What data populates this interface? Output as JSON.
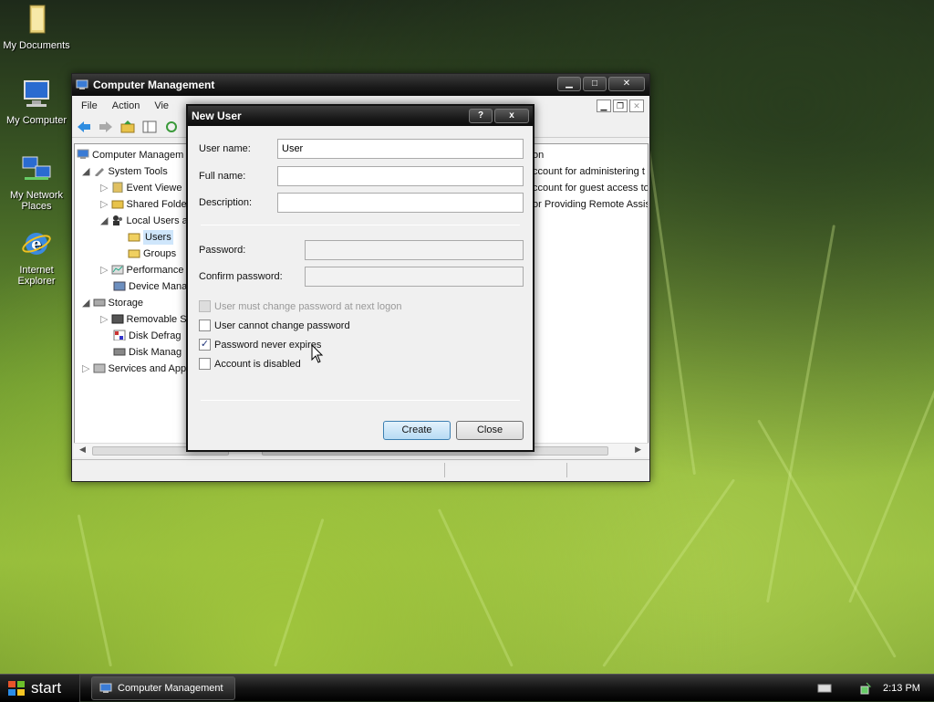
{
  "desktop": {
    "icons": [
      {
        "label": "My Documents",
        "icon": "folder-icon"
      },
      {
        "label": "My Computer",
        "icon": "computer-icon"
      },
      {
        "label": "My Network Places",
        "icon": "network-icon"
      },
      {
        "label": "Internet Explorer",
        "icon": "ie-icon"
      }
    ]
  },
  "cm_window": {
    "title": "Computer Management",
    "menu": [
      "File",
      "Action",
      "Vie"
    ],
    "tree": [
      {
        "label": "Computer Managem",
        "icon": "computer-icon"
      },
      {
        "label": "System Tools",
        "icon": "tools-icon"
      },
      {
        "label": "Event Viewe",
        "icon": "event-icon"
      },
      {
        "label": "Shared Folde",
        "icon": "shared-folder-icon"
      },
      {
        "label": "Local Users a",
        "icon": "users-icon"
      },
      {
        "label": "Users",
        "icon": "folder-icon"
      },
      {
        "label": "Groups",
        "icon": "folder-icon"
      },
      {
        "label": "Performance",
        "icon": "performance-icon"
      },
      {
        "label": "Device Mana",
        "icon": "device-icon"
      },
      {
        "label": "Storage",
        "icon": "storage-icon"
      },
      {
        "label": "Removable S",
        "icon": "removable-icon"
      },
      {
        "label": "Disk Defrag",
        "icon": "defrag-icon"
      },
      {
        "label": "Disk Manag",
        "icon": "disk-icon"
      },
      {
        "label": "Services and App",
        "icon": "services-icon"
      }
    ],
    "list_fragments": [
      "on",
      "ccount for administering t",
      "ccount for guest access to",
      "or Providing Remote Assis"
    ]
  },
  "new_user": {
    "title": "New User",
    "help_label": "?",
    "close_label": "x",
    "username_label": "User name:",
    "username_value": "User",
    "fullname_label": "Full name:",
    "fullname_value": "",
    "description_label": "Description:",
    "description_value": "",
    "password_label": "Password:",
    "confirm_label": "Confirm password:",
    "checkboxes": [
      {
        "label": "User must change password at next logon",
        "checked": false,
        "disabled": true
      },
      {
        "label": "User cannot change password",
        "checked": false,
        "disabled": false
      },
      {
        "label": "Password never expires",
        "checked": true,
        "disabled": false
      },
      {
        "label": "Account is disabled",
        "checked": false,
        "disabled": false
      }
    ],
    "create_label": "Create",
    "close_button_label": "Close"
  },
  "taskbar": {
    "start_label": "start",
    "task_label": "Computer Management",
    "clock": "2:13 PM"
  }
}
